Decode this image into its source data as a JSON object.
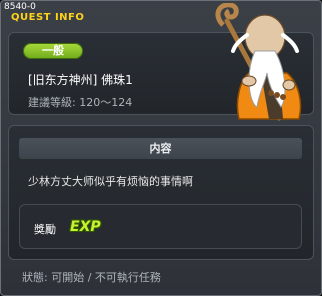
{
  "window": {
    "id_label": "8540-0",
    "title": "QUEST INFO"
  },
  "quest": {
    "category_badge": "一般",
    "name": "[旧东方神州] 佛珠1",
    "level_range": "建議等級: 120～124"
  },
  "content": {
    "header": "内容",
    "description": "少林方丈大师似乎有烦恼的事情啊"
  },
  "reward": {
    "label": "獎勵",
    "exp_icon_text": "EXP"
  },
  "status": {
    "text": "狀態: 可開始 / 不可執行任務"
  },
  "colors": {
    "title": "#ffd21a",
    "badge": "#8cc52a",
    "exp": "#c8f230"
  }
}
